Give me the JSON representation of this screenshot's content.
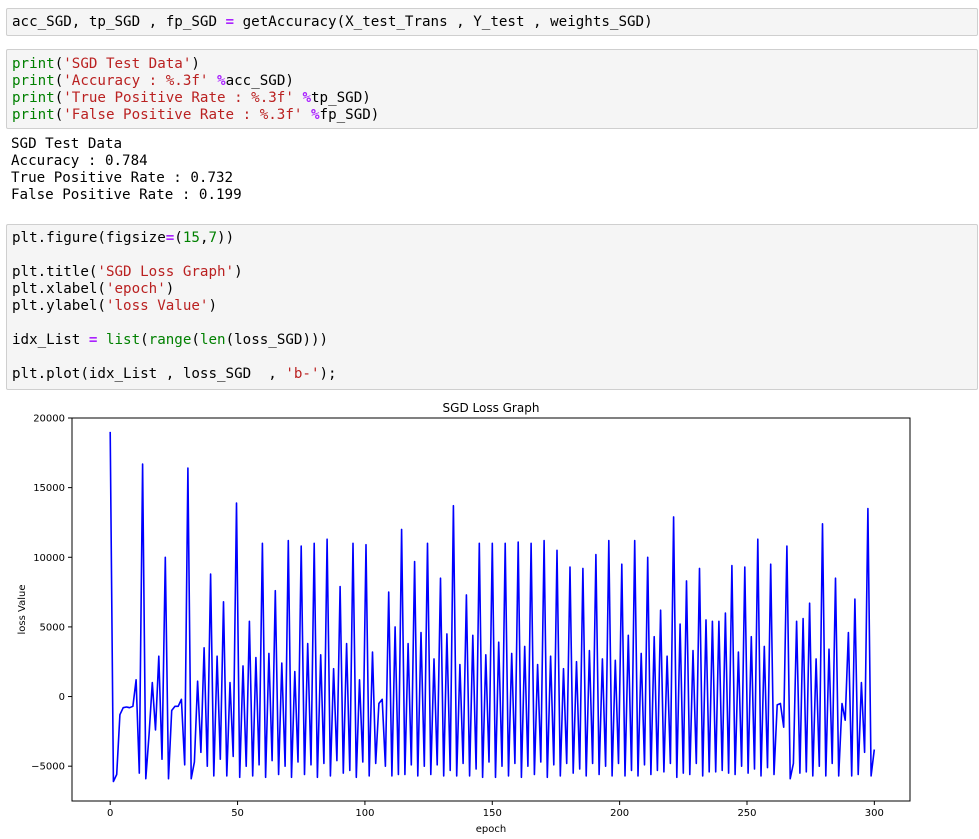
{
  "cells": [
    {
      "type": "code",
      "lines": [
        [
          [
            "t",
            "acc_SGD, tp_SGD , fp_SGD "
          ],
          [
            "op",
            "="
          ],
          [
            "t",
            " getAccuracy(X_test_Trans , Y_test , weights_SGD)"
          ]
        ]
      ]
    },
    {
      "type": "code",
      "lines": [
        [
          [
            "kw",
            "print"
          ],
          [
            "t",
            "("
          ],
          [
            "str",
            "'SGD Test Data'"
          ],
          [
            "t",
            ")"
          ]
        ],
        [
          [
            "kw",
            "print"
          ],
          [
            "t",
            "("
          ],
          [
            "str",
            "'Accuracy : %.3f'"
          ],
          [
            "t",
            " "
          ],
          [
            "op",
            "%"
          ],
          [
            "t",
            "acc_SGD)"
          ]
        ],
        [
          [
            "kw",
            "print"
          ],
          [
            "t",
            "("
          ],
          [
            "str",
            "'True Positive Rate : %.3f'"
          ],
          [
            "t",
            " "
          ],
          [
            "op",
            "%"
          ],
          [
            "t",
            "tp_SGD)"
          ]
        ],
        [
          [
            "kw",
            "print"
          ],
          [
            "t",
            "("
          ],
          [
            "str",
            "'False Positive Rate : %.3f'"
          ],
          [
            "t",
            " "
          ],
          [
            "op",
            "%"
          ],
          [
            "t",
            "fp_SGD)"
          ]
        ]
      ]
    },
    {
      "type": "output",
      "lines": [
        "SGD Test Data",
        "Accuracy : 0.784",
        "True Positive Rate : 0.732",
        "False Positive Rate : 0.199"
      ]
    },
    {
      "type": "code",
      "lines": [
        [
          [
            "t",
            "plt.figure(figsize"
          ],
          [
            "op",
            "="
          ],
          [
            "t",
            "("
          ],
          [
            "num",
            "15"
          ],
          [
            "t",
            ","
          ],
          [
            "num",
            "7"
          ],
          [
            "t",
            "))"
          ]
        ],
        [],
        [
          [
            "t",
            "plt.title("
          ],
          [
            "str",
            "'SGD Loss Graph'"
          ],
          [
            "t",
            ")"
          ]
        ],
        [
          [
            "t",
            "plt.xlabel("
          ],
          [
            "str",
            "'epoch'"
          ],
          [
            "t",
            ")"
          ]
        ],
        [
          [
            "t",
            "plt.ylabel("
          ],
          [
            "str",
            "'loss Value'"
          ],
          [
            "t",
            ")"
          ]
        ],
        [],
        [
          [
            "t",
            "idx_List "
          ],
          [
            "op",
            "="
          ],
          [
            "t",
            " "
          ],
          [
            "kw",
            "list"
          ],
          [
            "t",
            "("
          ],
          [
            "kw",
            "range"
          ],
          [
            "t",
            "("
          ],
          [
            "kw",
            "len"
          ],
          [
            "t",
            "(loss_SGD)))"
          ]
        ],
        [],
        [
          [
            "t",
            "plt.plot(idx_List , loss_SGD  , "
          ],
          [
            "str",
            "'b-'"
          ],
          [
            "t",
            ");"
          ]
        ]
      ]
    }
  ],
  "colors": {
    "keyword": "#008000",
    "string": "#ba2121",
    "operator": "#aa22ff",
    "number": "#008000",
    "line": "#0000ff"
  },
  "chart_data": {
    "type": "line",
    "title": "SGD Loss Graph",
    "xlabel": "epoch",
    "ylabel": "loss Value",
    "xlim": [
      -15,
      314
    ],
    "ylim": [
      -7500,
      20000
    ],
    "xticks": [
      0,
      50,
      100,
      150,
      200,
      250,
      300
    ],
    "yticks": [
      -5000,
      0,
      5000,
      10000,
      15000,
      20000
    ],
    "ytick_labels": [
      "−5000",
      "0",
      "5000",
      "10000",
      "15000",
      "20000"
    ],
    "grid": false,
    "series": [
      {
        "style": "b-",
        "points": [
          [
            0,
            19000
          ],
          [
            1,
            -6100
          ],
          [
            2,
            -5600
          ],
          [
            3,
            -1300
          ],
          [
            4,
            -800
          ],
          [
            5,
            -750
          ],
          [
            6,
            -800
          ],
          [
            7,
            -700
          ],
          [
            8,
            1200
          ],
          [
            9,
            -5500
          ],
          [
            10,
            16700
          ],
          [
            11,
            -5900
          ],
          [
            12,
            -2700
          ],
          [
            13,
            1000
          ],
          [
            14,
            -2400
          ],
          [
            15,
            2900
          ],
          [
            16,
            -4500
          ],
          [
            17,
            10000
          ],
          [
            18,
            -5900
          ],
          [
            19,
            -1000
          ],
          [
            20,
            -700
          ],
          [
            21,
            -700
          ],
          [
            22,
            -200
          ],
          [
            23,
            -4900
          ],
          [
            24,
            16400
          ],
          [
            25,
            -5900
          ],
          [
            26,
            -4700
          ],
          [
            27,
            1100
          ],
          [
            28,
            -4000
          ],
          [
            29,
            3500
          ],
          [
            30,
            -5000
          ],
          [
            31,
            8800
          ],
          [
            32,
            -5700
          ],
          [
            33,
            2900
          ],
          [
            34,
            -4500
          ],
          [
            35,
            6800
          ],
          [
            36,
            -5700
          ],
          [
            37,
            1000
          ],
          [
            38,
            -4300
          ],
          [
            39,
            13900
          ],
          [
            40,
            -5800
          ],
          [
            41,
            2200
          ],
          [
            42,
            -5000
          ],
          [
            43,
            5400
          ],
          [
            44,
            -5700
          ],
          [
            45,
            2800
          ],
          [
            46,
            -4900
          ],
          [
            47,
            11000
          ],
          [
            48,
            -5800
          ],
          [
            49,
            3100
          ],
          [
            50,
            -4600
          ],
          [
            51,
            7600
          ],
          [
            52,
            -5600
          ],
          [
            53,
            2400
          ],
          [
            54,
            -5000
          ],
          [
            55,
            11200
          ],
          [
            56,
            -5800
          ],
          [
            57,
            1800
          ],
          [
            58,
            -4700
          ],
          [
            59,
            10800
          ],
          [
            60,
            -5600
          ],
          [
            61,
            3800
          ],
          [
            62,
            -4900
          ],
          [
            63,
            11000
          ],
          [
            64,
            -5800
          ],
          [
            65,
            3000
          ],
          [
            66,
            -4800
          ],
          [
            67,
            11300
          ],
          [
            68,
            -5700
          ],
          [
            69,
            2000
          ],
          [
            70,
            -4600
          ],
          [
            71,
            7900
          ],
          [
            72,
            -5500
          ],
          [
            73,
            3800
          ],
          [
            74,
            -5300
          ],
          [
            75,
            11000
          ],
          [
            76,
            -5800
          ],
          [
            77,
            1200
          ],
          [
            78,
            -4700
          ],
          [
            79,
            10900
          ],
          [
            80,
            -5700
          ],
          [
            81,
            3200
          ],
          [
            82,
            -4800
          ],
          [
            83,
            -500
          ],
          [
            84,
            -200
          ],
          [
            85,
            -5000
          ],
          [
            86,
            7500
          ],
          [
            87,
            -5700
          ],
          [
            88,
            5000
          ],
          [
            89,
            -5600
          ],
          [
            90,
            12000
          ],
          [
            91,
            -5600
          ],
          [
            92,
            3800
          ],
          [
            93,
            -4900
          ],
          [
            94,
            9700
          ],
          [
            95,
            -5700
          ],
          [
            96,
            4600
          ],
          [
            97,
            -5000
          ],
          [
            98,
            11000
          ],
          [
            99,
            -5600
          ],
          [
            100,
            2700
          ],
          [
            101,
            -4900
          ],
          [
            102,
            8500
          ],
          [
            103,
            -5700
          ],
          [
            104,
            4500
          ],
          [
            105,
            -5300
          ],
          [
            106,
            13700
          ],
          [
            107,
            -5700
          ],
          [
            108,
            2300
          ],
          [
            109,
            -4800
          ],
          [
            110,
            7300
          ],
          [
            111,
            -5700
          ],
          [
            112,
            4400
          ],
          [
            113,
            -5200
          ],
          [
            114,
            11000
          ],
          [
            115,
            -5800
          ],
          [
            116,
            3000
          ],
          [
            117,
            -4700
          ],
          [
            118,
            11000
          ],
          [
            119,
            -5800
          ],
          [
            120,
            3900
          ],
          [
            121,
            -5000
          ],
          [
            122,
            11000
          ],
          [
            123,
            -5700
          ],
          [
            124,
            3100
          ],
          [
            125,
            -4800
          ],
          [
            126,
            11100
          ],
          [
            127,
            -5800
          ],
          [
            128,
            3600
          ],
          [
            129,
            -5000
          ],
          [
            130,
            11000
          ],
          [
            131,
            -5600
          ],
          [
            132,
            2300
          ],
          [
            133,
            -4700
          ],
          [
            134,
            11200
          ],
          [
            135,
            -5800
          ],
          [
            136,
            2900
          ],
          [
            137,
            -4900
          ],
          [
            138,
            10500
          ],
          [
            139,
            -5700
          ],
          [
            140,
            2000
          ],
          [
            141,
            -4800
          ],
          [
            142,
            9300
          ],
          [
            143,
            -5500
          ],
          [
            144,
            2500
          ],
          [
            145,
            -5200
          ],
          [
            146,
            9200
          ],
          [
            147,
            -5700
          ],
          [
            148,
            3300
          ],
          [
            149,
            -4800
          ],
          [
            150,
            10200
          ],
          [
            151,
            -5600
          ],
          [
            152,
            2700
          ],
          [
            153,
            -5000
          ],
          [
            154,
            11200
          ],
          [
            155,
            -5700
          ],
          [
            156,
            2600
          ],
          [
            157,
            -4800
          ],
          [
            158,
            9500
          ],
          [
            159,
            -5700
          ],
          [
            160,
            4400
          ],
          [
            161,
            -5300
          ],
          [
            162,
            11200
          ],
          [
            163,
            -5700
          ],
          [
            164,
            3100
          ],
          [
            165,
            -4900
          ],
          [
            166,
            10000
          ],
          [
            167,
            -5600
          ],
          [
            168,
            4300
          ],
          [
            169,
            -5300
          ],
          [
            170,
            6200
          ],
          [
            171,
            -5400
          ],
          [
            172,
            2900
          ],
          [
            173,
            -4800
          ],
          [
            174,
            12900
          ],
          [
            175,
            -5800
          ],
          [
            176,
            5200
          ],
          [
            177,
            -5500
          ],
          [
            178,
            8300
          ],
          [
            179,
            -5600
          ],
          [
            180,
            3300
          ],
          [
            181,
            -4800
          ],
          [
            182,
            9200
          ],
          [
            183,
            -5700
          ],
          [
            184,
            5500
          ],
          [
            185,
            -5400
          ],
          [
            186,
            5400
          ],
          [
            187,
            -5400
          ],
          [
            188,
            5400
          ],
          [
            189,
            -5300
          ],
          [
            190,
            6000
          ],
          [
            191,
            -5500
          ],
          [
            192,
            9400
          ],
          [
            193,
            -5600
          ],
          [
            194,
            3200
          ],
          [
            195,
            -5000
          ],
          [
            196,
            9300
          ],
          [
            197,
            -5500
          ],
          [
            198,
            4300
          ],
          [
            199,
            -5200
          ],
          [
            200,
            11300
          ],
          [
            201,
            -5700
          ],
          [
            202,
            3600
          ],
          [
            203,
            -5100
          ],
          [
            204,
            9500
          ],
          [
            205,
            -5600
          ],
          [
            206,
            -600
          ],
          [
            207,
            -500
          ],
          [
            208,
            -2200
          ],
          [
            209,
            10800
          ],
          [
            210,
            -5900
          ],
          [
            211,
            -4800
          ],
          [
            212,
            5400
          ],
          [
            213,
            -5500
          ],
          [
            214,
            5600
          ],
          [
            215,
            -5400
          ],
          [
            216,
            6700
          ],
          [
            217,
            -5700
          ],
          [
            218,
            2700
          ],
          [
            219,
            -5000
          ],
          [
            220,
            12400
          ],
          [
            221,
            -5700
          ],
          [
            222,
            3400
          ],
          [
            223,
            -4800
          ],
          [
            224,
            8500
          ],
          [
            225,
            -5700
          ],
          [
            226,
            -500
          ],
          [
            227,
            -1700
          ],
          [
            228,
            4600
          ],
          [
            229,
            -5700
          ],
          [
            230,
            7000
          ],
          [
            231,
            -5600
          ],
          [
            232,
            1000
          ],
          [
            233,
            -4000
          ],
          [
            234,
            13500
          ],
          [
            235,
            -5700
          ],
          [
            236,
            -3800
          ]
        ]
      }
    ]
  },
  "chart_x_scale": {
    "last_index": 236,
    "last_epoch": 300
  }
}
